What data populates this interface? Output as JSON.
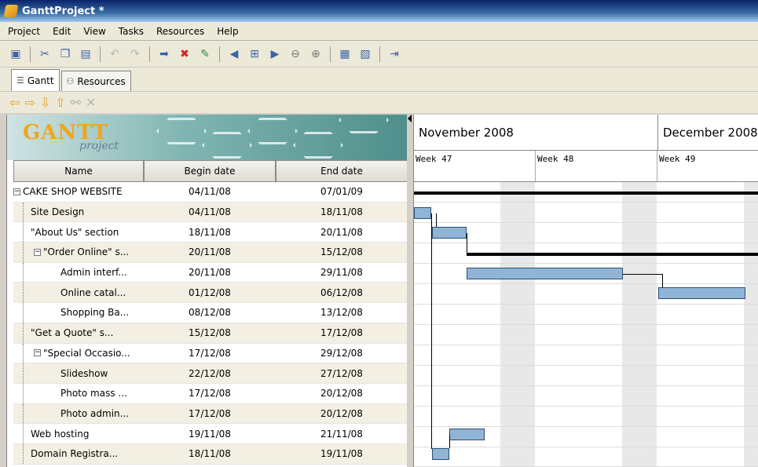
{
  "window": {
    "title": "GanttProject *"
  },
  "menu": [
    "Project",
    "Edit",
    "View",
    "Tasks",
    "Resources",
    "Help"
  ],
  "tabs": [
    {
      "label": "Gantt"
    },
    {
      "label": "Resources"
    }
  ],
  "logo": {
    "main": "GANTT",
    "sub": "project"
  },
  "table": {
    "headers": [
      "Name",
      "Begin date",
      "End date"
    ],
    "rows": [
      {
        "name": "CAKE SHOP WEBSITE",
        "begin": "04/11/08",
        "end": "07/01/09"
      },
      {
        "name": "Site Design",
        "begin": "04/11/08",
        "end": "18/11/08"
      },
      {
        "name": "\"About Us\" section",
        "begin": "18/11/08",
        "end": "20/11/08"
      },
      {
        "name": "\"Order Online\" s...",
        "begin": "20/11/08",
        "end": "15/12/08"
      },
      {
        "name": "Admin interf...",
        "begin": "20/11/08",
        "end": "29/11/08"
      },
      {
        "name": "Online catal...",
        "begin": "01/12/08",
        "end": "06/12/08"
      },
      {
        "name": "Shopping Ba...",
        "begin": "08/12/08",
        "end": "13/12/08"
      },
      {
        "name": "\"Get a Quote\" s...",
        "begin": "15/12/08",
        "end": "17/12/08"
      },
      {
        "name": "\"Special Occasio...",
        "begin": "17/12/08",
        "end": "29/12/08"
      },
      {
        "name": "Slideshow",
        "begin": "22/12/08",
        "end": "27/12/08"
      },
      {
        "name": "Photo mass ...",
        "begin": "17/12/08",
        "end": "20/12/08"
      },
      {
        "name": "Photo admin...",
        "begin": "17/12/08",
        "end": "20/12/08"
      },
      {
        "name": "Web hosting",
        "begin": "19/11/08",
        "end": "21/11/08"
      },
      {
        "name": "Domain Registra...",
        "begin": "18/11/08",
        "end": "19/11/08"
      }
    ]
  },
  "timeline": {
    "months": [
      "November 2008",
      "December 2008"
    ],
    "weeks": [
      "Week 47",
      "Week 48",
      "Week 49"
    ]
  },
  "colors": {
    "bar": "#8fb4d6",
    "bar_border": "#2f4e6e",
    "title_bar": "#0a246a"
  },
  "icons": {
    "toolbar": [
      "save-icon",
      "cut-icon",
      "copy-icon",
      "paste-icon",
      "undo-icon",
      "redo-icon",
      "new-task-icon",
      "delete-icon",
      "properties-icon",
      "scroll-left-icon",
      "fit-icon",
      "scroll-right-icon",
      "zoom-out-icon",
      "zoom-in-icon",
      "print-icon",
      "preview-icon",
      "indent-icon"
    ],
    "nav": [
      "arrow-left-icon",
      "arrow-right-icon",
      "arrow-down-icon",
      "arrow-up-icon",
      "link-icon",
      "unlink-icon"
    ]
  }
}
